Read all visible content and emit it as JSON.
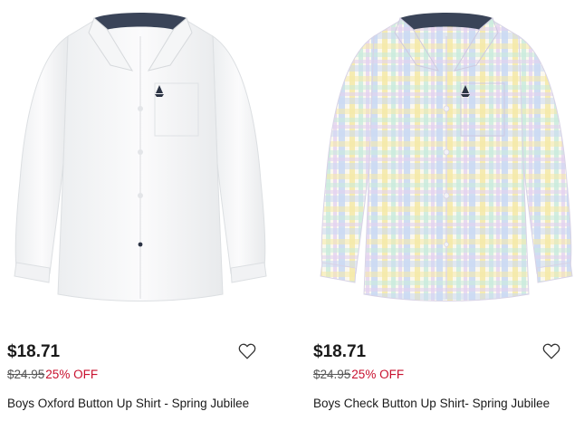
{
  "colors": {
    "discount": "#c8102e",
    "text": "#1a1a1a",
    "old_price": "#555555"
  },
  "products": [
    {
      "price": "$18.71",
      "old_price": "$24.95",
      "discount": "25% OFF",
      "title": "Boys Oxford Button Up Shirt - Spring Jubilee",
      "favorite_icon": "heart-outline-icon"
    },
    {
      "price": "$18.71",
      "old_price": "$24.95",
      "discount": "25% OFF",
      "title": "Boys Check Button Up Shirt- Spring Jubilee",
      "favorite_icon": "heart-outline-icon"
    }
  ]
}
